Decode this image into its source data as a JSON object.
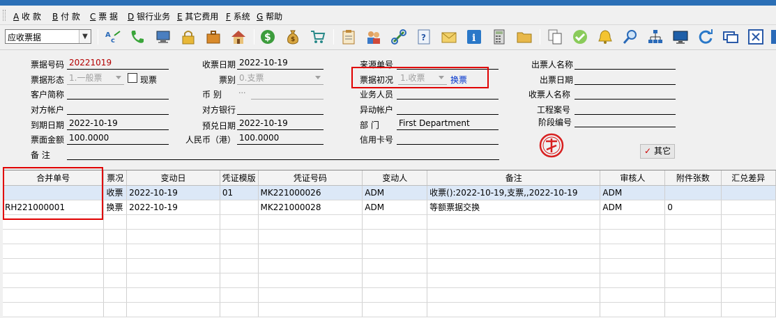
{
  "menu": [
    {
      "key": "A",
      "label": "收  款"
    },
    {
      "key": "B",
      "label": "付  款"
    },
    {
      "key": "C",
      "label": "票  据"
    },
    {
      "key": "D",
      "label": "银行业务"
    },
    {
      "key": "E",
      "label": "其它费用"
    },
    {
      "key": "F",
      "label": "系统"
    },
    {
      "key": "G",
      "label": "帮助"
    }
  ],
  "toolbar": {
    "selector_value": "应收票据",
    "icons": [
      "abc-spell-icon",
      "phone-icon",
      "monitor-icon",
      "lock-icon",
      "briefcase-icon",
      "home-icon",
      "dollar-coin-icon",
      "money-bag-icon",
      "shopping-cart-icon",
      "clipboard-icon",
      "users-icon",
      "link-icon",
      "help-icon",
      "mail-icon",
      "info-icon",
      "calculator-icon",
      "folder-icon",
      "copy-icon",
      "check-circle-icon",
      "bell-icon",
      "search-icon",
      "org-chart-icon",
      "display-icon",
      "refresh-icon",
      "windows-icon",
      "close-icon",
      "extra-icon"
    ]
  },
  "form": {
    "bill_no_label": "票据号码",
    "bill_no": "20221019",
    "form_label": "票据形态",
    "form_value": "1.一般票",
    "cash_label": "现票",
    "customer_label": "客户简称",
    "customer": "",
    "account_label": "对方帐户",
    "account": "",
    "due_label": "到期日期",
    "due_date": "2022-10-19",
    "amount_label": "票面金额",
    "amount": "100.0000",
    "remark_label": "备    注",
    "remark": "",
    "receive_date_label": "收票日期",
    "receive_date": "2022-10-19",
    "type_label": "票别",
    "type_value": "0.支票",
    "currency_label": "币    别",
    "currency": "",
    "bank_label": "对方银行",
    "bank": "",
    "expect_label": "预兑日期",
    "expect_date": "2022-10-19",
    "rmb_label": "人民币（港）",
    "rmb": "100.0000",
    "source_label": "来源单号",
    "source": "",
    "initial_label": "票据初况",
    "initial_value": "1.收票",
    "exchange_link": "换票",
    "staff_label": "业务人员",
    "staff": "",
    "change_acct_label": "异动帐户",
    "change_acct": "",
    "dept_label": "部    门",
    "dept": "First Department",
    "card_label": "信用卡号",
    "card": "",
    "drawer_label": "出票人名称",
    "drawer": "",
    "draw_date_label": "出票日期",
    "draw_date": "",
    "payee_label": "收票人名称",
    "payee": "",
    "project_label": "工程案号",
    "project": "",
    "stage_label": "阶段编号",
    "stage": "",
    "other_button": "其它",
    "more_dots": "···"
  },
  "grid": {
    "columns": [
      "合并单号",
      "票况",
      "变动日",
      "凭证模版",
      "凭证号码",
      "变动人",
      "备注",
      "审核人",
      "附件张数",
      "汇兑差异"
    ],
    "rows": [
      [
        "",
        "收票",
        "2022-10-19",
        "01",
        "MK221000026",
        "ADM",
        "收票():2022-10-19,支票,,2022-10-19",
        "ADM",
        "",
        ""
      ],
      [
        "RH221000001",
        "换票",
        "2022-10-19",
        "",
        "MK221000028",
        "ADM",
        "等额票据交换",
        "ADM",
        "0",
        ""
      ]
    ],
    "empty_rows": 7
  }
}
